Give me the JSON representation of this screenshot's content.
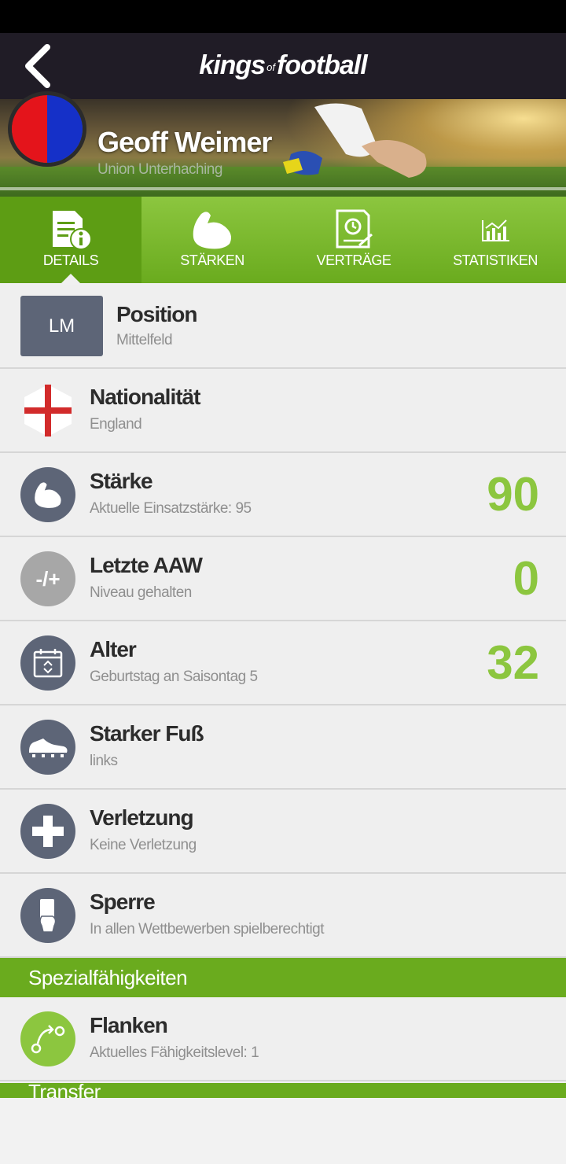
{
  "header": {
    "logo_main": "kings",
    "logo_of": "of",
    "logo_end": "football"
  },
  "player": {
    "name": "Geoff Weimer",
    "club": "Union Unterhaching"
  },
  "tabs": [
    {
      "label": "DETAILS",
      "icon": "document-info-icon",
      "active": true
    },
    {
      "label": "STÄRKEN",
      "icon": "muscle-icon",
      "active": false
    },
    {
      "label": "VERTRÄGE",
      "icon": "contract-icon",
      "active": false
    },
    {
      "label": "STATISTIKEN",
      "icon": "stats-chart-icon",
      "active": false
    }
  ],
  "details": {
    "position": {
      "badge": "LM",
      "title": "Position",
      "sub": "Mittelfeld"
    },
    "nationality": {
      "title": "Nationalität",
      "sub": "England",
      "icon": "england-flag-icon"
    },
    "strength": {
      "title": "Stärke",
      "sub": "Aktuelle Einsatzstärke: 95",
      "value": "90",
      "icon": "muscle-icon"
    },
    "last_aaw": {
      "title": "Letzte AAW",
      "sub": "Niveau gehalten",
      "value": "0",
      "icon_text": "-/+"
    },
    "age": {
      "title": "Alter",
      "sub": "Geburtstag an Saisontag 5",
      "value": "32",
      "icon": "calendar-icon"
    },
    "foot": {
      "title": "Starker Fuß",
      "sub": "links",
      "icon": "boot-icon"
    },
    "injury": {
      "title": "Verletzung",
      "sub": "Keine Verletzung",
      "icon": "cross-icon"
    },
    "suspension": {
      "title": "Sperre",
      "sub": "In allen Wettbewerben spielberechtigt",
      "icon": "card-hand-icon"
    }
  },
  "special": {
    "header": "Spezialfähigkeiten",
    "items": [
      {
        "title": "Flanken",
        "sub": "Aktuelles Fähigkeitslevel: 1",
        "icon": "cross-pass-icon"
      }
    ]
  },
  "next_section": {
    "header": "Transfer"
  },
  "colors": {
    "accent_green": "#8cc63f",
    "dark_green": "#6aab1e",
    "header_bg": "#201c26",
    "icon_bg": "#5d6577"
  }
}
